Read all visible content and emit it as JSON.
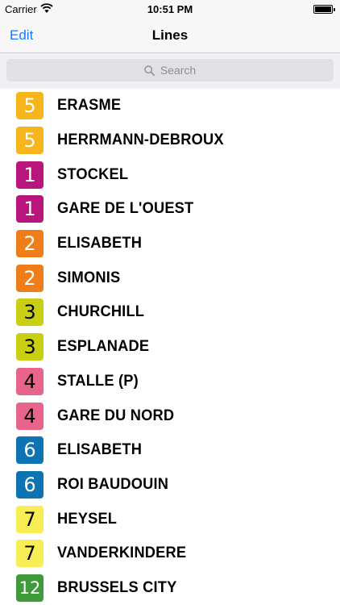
{
  "status_bar": {
    "carrier": "Carrier",
    "time": "10:51 PM"
  },
  "nav": {
    "edit_label": "Edit",
    "title": "Lines"
  },
  "search": {
    "placeholder": "Search"
  },
  "lines": [
    {
      "number": "5",
      "destination": "ERASME",
      "color": "#f6b51b",
      "text_color": "#ffffff"
    },
    {
      "number": "5",
      "destination": "HERRMANN-DEBROUX",
      "color": "#f6b51b",
      "text_color": "#ffffff"
    },
    {
      "number": "1",
      "destination": "STOCKEL",
      "color": "#b8157d",
      "text_color": "#ffffff"
    },
    {
      "number": "1",
      "destination": "GARE DE L'OUEST",
      "color": "#b8157d",
      "text_color": "#ffffff"
    },
    {
      "number": "2",
      "destination": "ELISABETH",
      "color": "#ef7d1a",
      "text_color": "#ffffff"
    },
    {
      "number": "2",
      "destination": "SIMONIS",
      "color": "#ef7d1a",
      "text_color": "#ffffff"
    },
    {
      "number": "3",
      "destination": "CHURCHILL",
      "color": "#c9cf13",
      "text_color": "#000000"
    },
    {
      "number": "3",
      "destination": "ESPLANADE",
      "color": "#c9cf13",
      "text_color": "#000000"
    },
    {
      "number": "4",
      "destination": "STALLE (P)",
      "color": "#e9648b",
      "text_color": "#000000"
    },
    {
      "number": "4",
      "destination": "GARE DU NORD",
      "color": "#e9648b",
      "text_color": "#000000"
    },
    {
      "number": "6",
      "destination": "ELISABETH",
      "color": "#0d73b3",
      "text_color": "#ffffff"
    },
    {
      "number": "6",
      "destination": "ROI BAUDOUIN",
      "color": "#0d73b3",
      "text_color": "#ffffff"
    },
    {
      "number": "7",
      "destination": "HEYSEL",
      "color": "#f7ee55",
      "text_color": "#000000"
    },
    {
      "number": "7",
      "destination": "VANDERKINDERE",
      "color": "#f7ee55",
      "text_color": "#000000"
    },
    {
      "number": "12",
      "destination": "BRUSSELS CITY",
      "color": "#3f9a3a",
      "text_color": "#ffffff"
    }
  ]
}
